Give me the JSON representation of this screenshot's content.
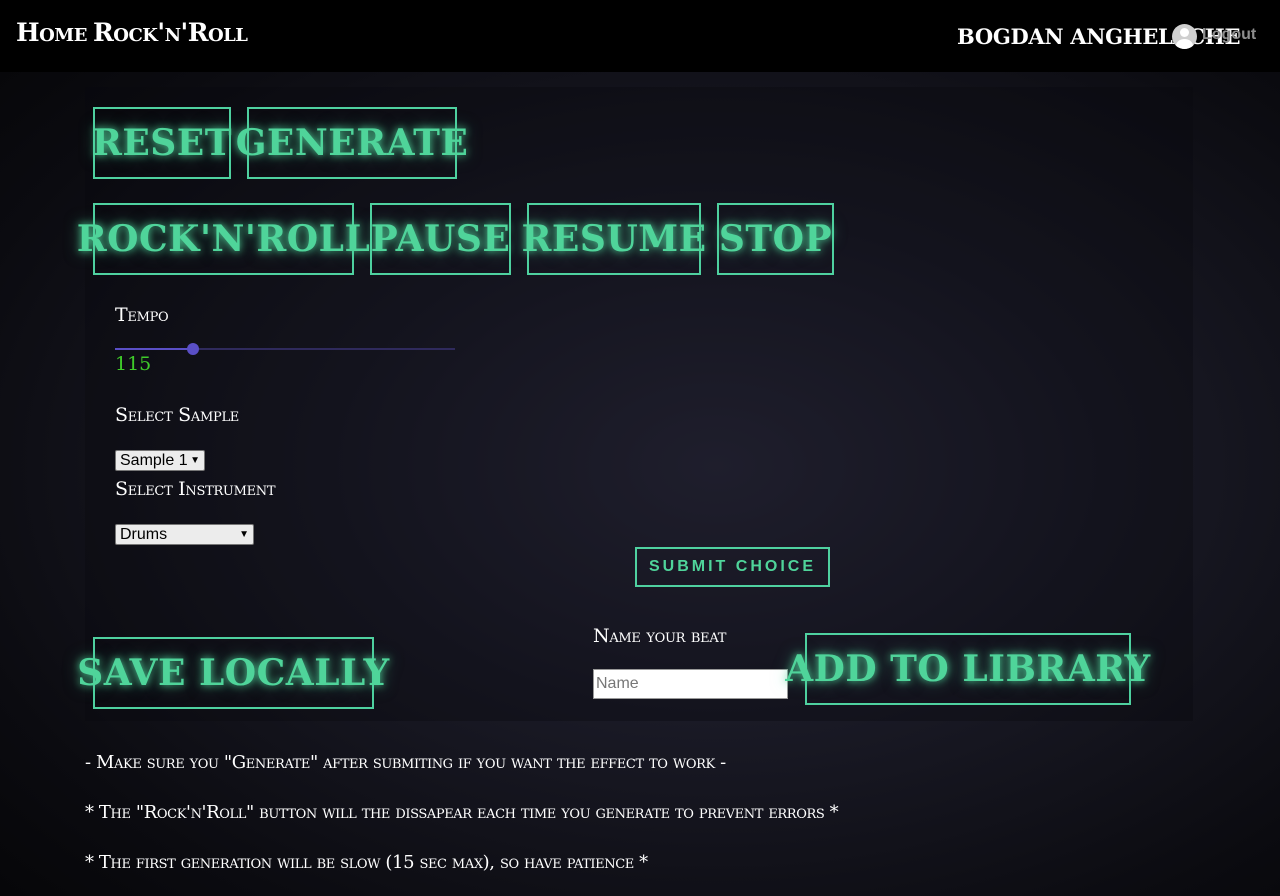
{
  "nav": {
    "home": "Home",
    "rocknroll": "Rock'n'Roll",
    "user_name": "BOGDAN ANGHELACHE",
    "logout": "Logout",
    "avatar_icon": "user-avatar-icon"
  },
  "controls": {
    "reset": "Reset",
    "generate": "Generate",
    "rocknroll": "Rock'n'Roll",
    "pause": "Pause",
    "resume": "Resume",
    "stop": "Stop"
  },
  "tempo": {
    "label": "Tempo",
    "value": "115",
    "fraction": 0.23
  },
  "sample": {
    "label": "Select Sample",
    "selected": "Sample 1"
  },
  "instrument": {
    "label": "Select Instrument",
    "selected": "Drums"
  },
  "submit": "SUBMIT CHOICE",
  "save": {
    "save_locally": "Save locally",
    "name_label": "Name your beat",
    "name_placeholder": "Name",
    "add_to_library": "Add to library"
  },
  "notes": [
    "- Make sure you \"Generate\" after submiting if you want the effect to work -",
    "* The \"Rock'n'Roll\" button will the dissapear each time you generate to prevent errors *",
    "* The first generation will be slow (15 sec max), so have patience *"
  ],
  "colors": {
    "accent": "#4fd49a",
    "tempo_value": "#3fcc2a",
    "slider": "#5a4fc6"
  }
}
